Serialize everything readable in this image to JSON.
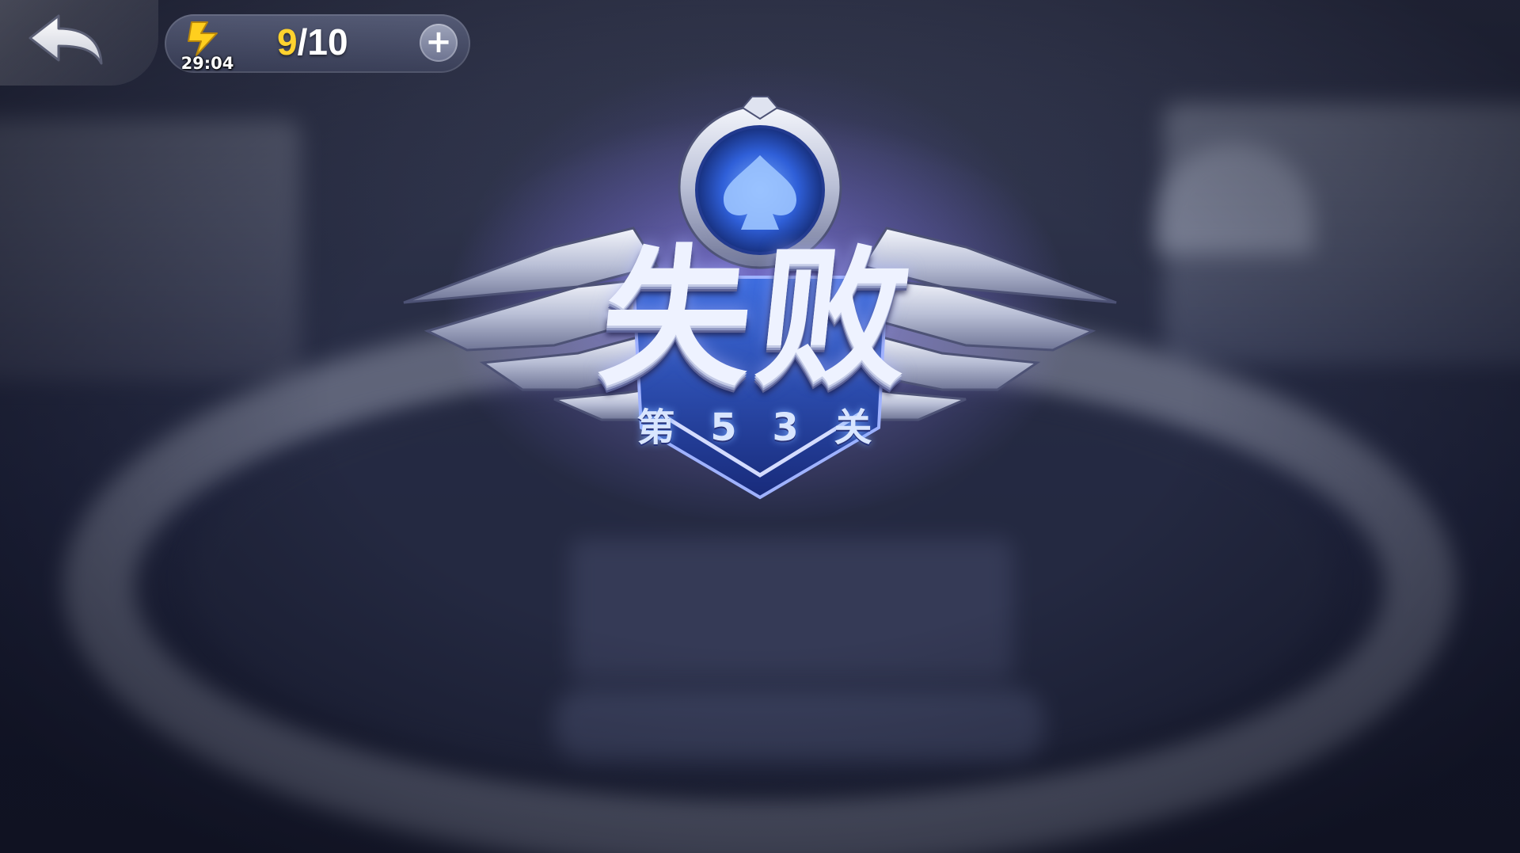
{
  "hud": {
    "back_icon": "back-arrow-icon",
    "energy": {
      "icon": "energy-lightning-icon",
      "timer": "29:04",
      "current": "9",
      "separator_max": "/10",
      "add_icon": "plus-icon"
    }
  },
  "result": {
    "title": "失败",
    "level": "第 5 3 关",
    "emblem_icon": "spade-emblem-icon"
  },
  "colors": {
    "energy_current": "#ffd22e",
    "badge_glow": "#8476e6",
    "badge_blue": "#2a4fc0"
  }
}
